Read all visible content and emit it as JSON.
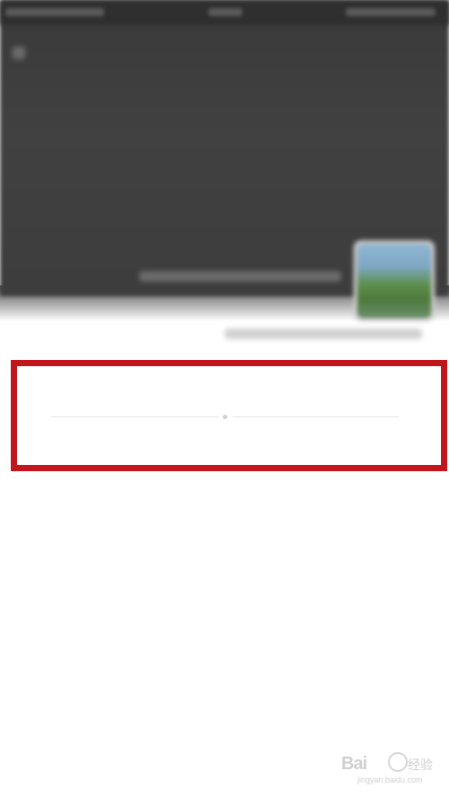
{
  "profile": {
    "cover_color": "#3f3f3f",
    "avatar_icon": "landscape-avatar"
  },
  "highlight": {
    "color": "#c0161c"
  },
  "feed": {
    "empty_text": ""
  },
  "watermark": {
    "logo": "Bai",
    "label": "经验",
    "url": "jingyan.baidu.com"
  }
}
